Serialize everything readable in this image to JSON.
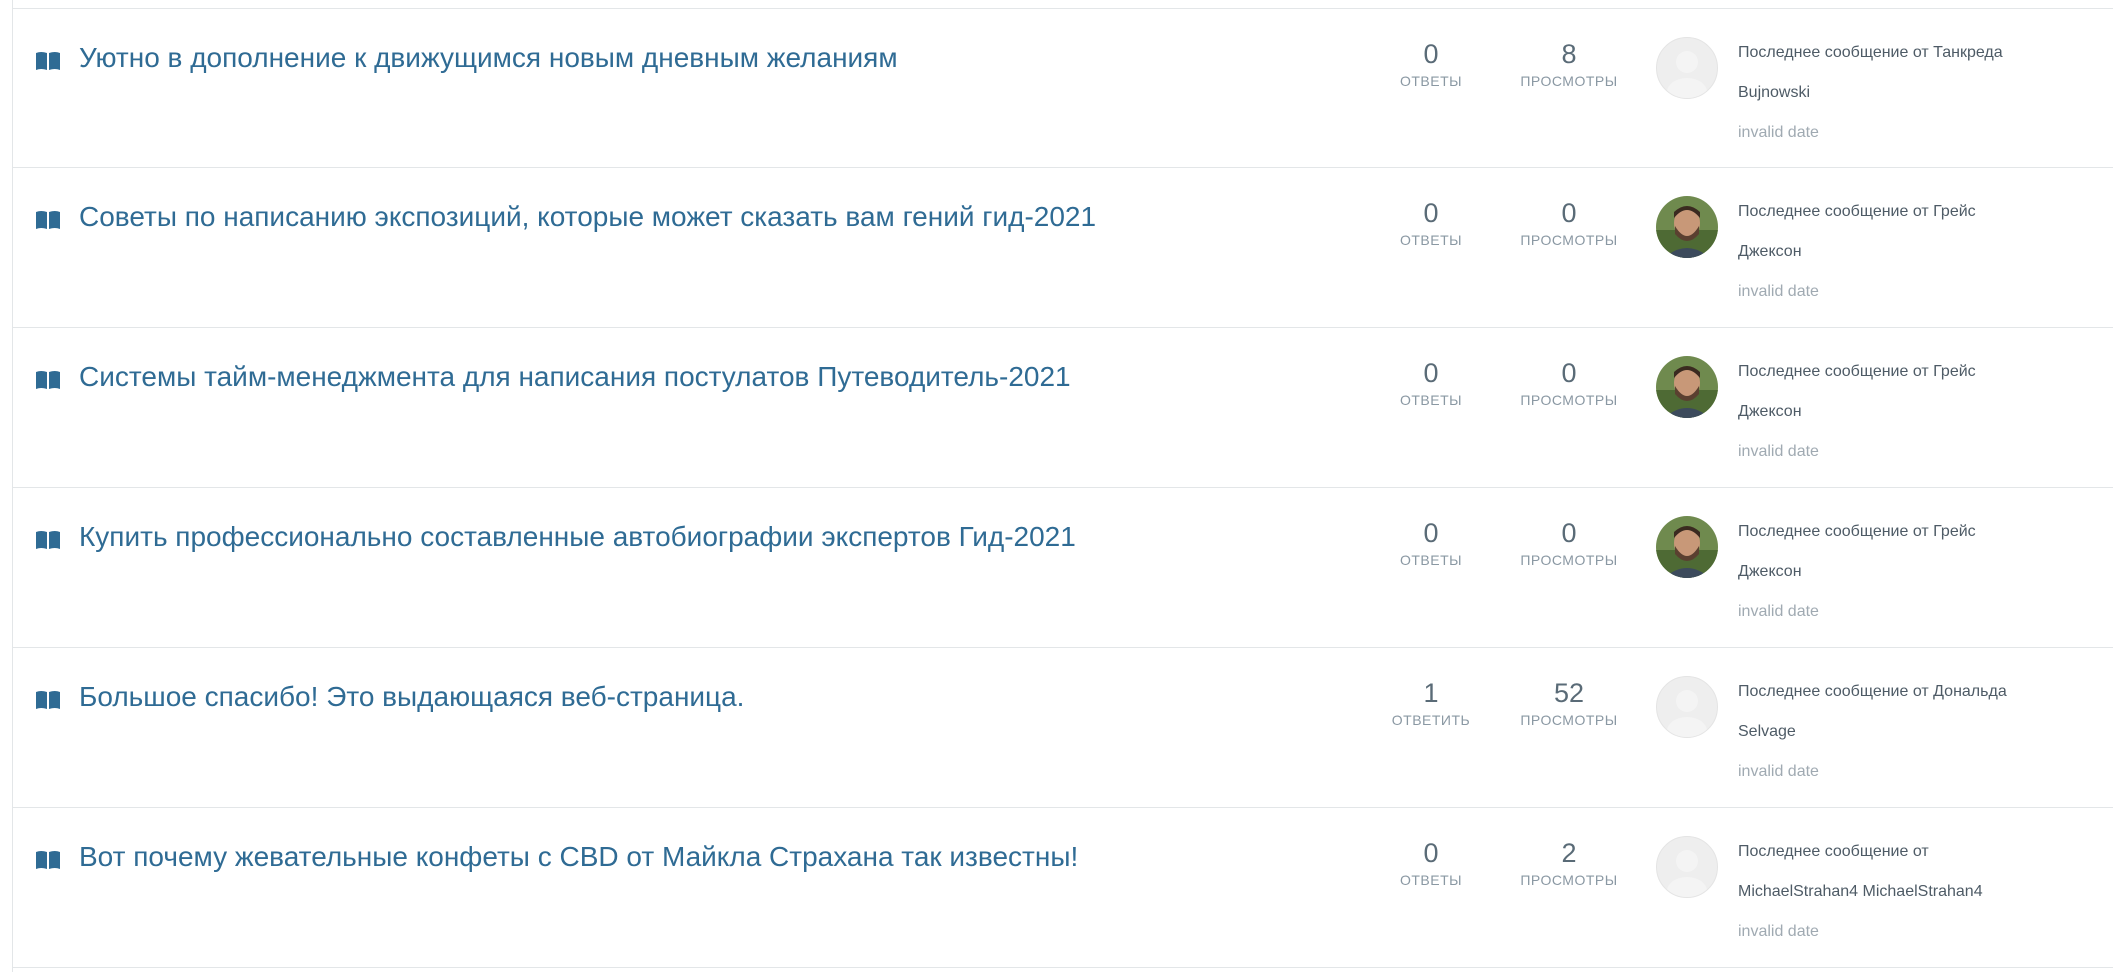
{
  "topics": [
    {
      "title": "Уютно в дополнение к движущимся новым дневным желаниям",
      "replies": "0",
      "replies_label": "ОТВЕТЫ",
      "views": "8",
      "views_label": "ПРОСМОТРЫ",
      "last_line1": "Последнее сообщение от Танкреда",
      "last_line2": "Bujnowski",
      "date": "invalid date",
      "avatar": "placeholder"
    },
    {
      "title": "Советы по написанию экспозиций, которые может сказать вам гений гид-2021",
      "replies": "0",
      "replies_label": "ОТВЕТЫ",
      "views": "0",
      "views_label": "ПРОСМОТРЫ",
      "last_line1": "Последнее сообщение от Грейс",
      "last_line2": "Джексон",
      "date": "invalid date",
      "avatar": "photo"
    },
    {
      "title": "Системы тайм-менеджмента для написания постулатов Путеводитель-2021",
      "replies": "0",
      "replies_label": "ОТВЕТЫ",
      "views": "0",
      "views_label": "ПРОСМОТРЫ",
      "last_line1": "Последнее сообщение от Грейс",
      "last_line2": "Джексон",
      "date": "invalid date",
      "avatar": "photo"
    },
    {
      "title": "Купить профессионально составленные автобиографии экспертов Гид-2021",
      "replies": "0",
      "replies_label": "ОТВЕТЫ",
      "views": "0",
      "views_label": "ПРОСМОТРЫ",
      "last_line1": "Последнее сообщение от Грейс",
      "last_line2": "Джексон",
      "date": "invalid date",
      "avatar": "photo"
    },
    {
      "title": "Большое спасибо! Это выдающаяся веб-страница.",
      "replies": "1",
      "replies_label": "ОТВЕТИТЬ",
      "views": "52",
      "views_label": "ПРОСМОТРЫ",
      "last_line1": "Последнее сообщение от Дональда",
      "last_line2": "Selvage",
      "date": "invalid date",
      "avatar": "placeholder"
    },
    {
      "title": "Вот почему жевательные конфеты с CBD от Майкла Страхана так известны!",
      "replies": "0",
      "replies_label": "ОТВЕТЫ",
      "views": "2",
      "views_label": "ПРОСМОТРЫ",
      "last_line1": "Последнее сообщение от",
      "last_line2": "MichaelStrahan4 MichaelStrahan4",
      "date": "invalid date",
      "avatar": "placeholder"
    }
  ],
  "colors": {
    "title": "#2f6b94",
    "muted": "#8a98a3",
    "border": "#e3e6e8"
  },
  "icons": {
    "topic": "book-icon"
  }
}
